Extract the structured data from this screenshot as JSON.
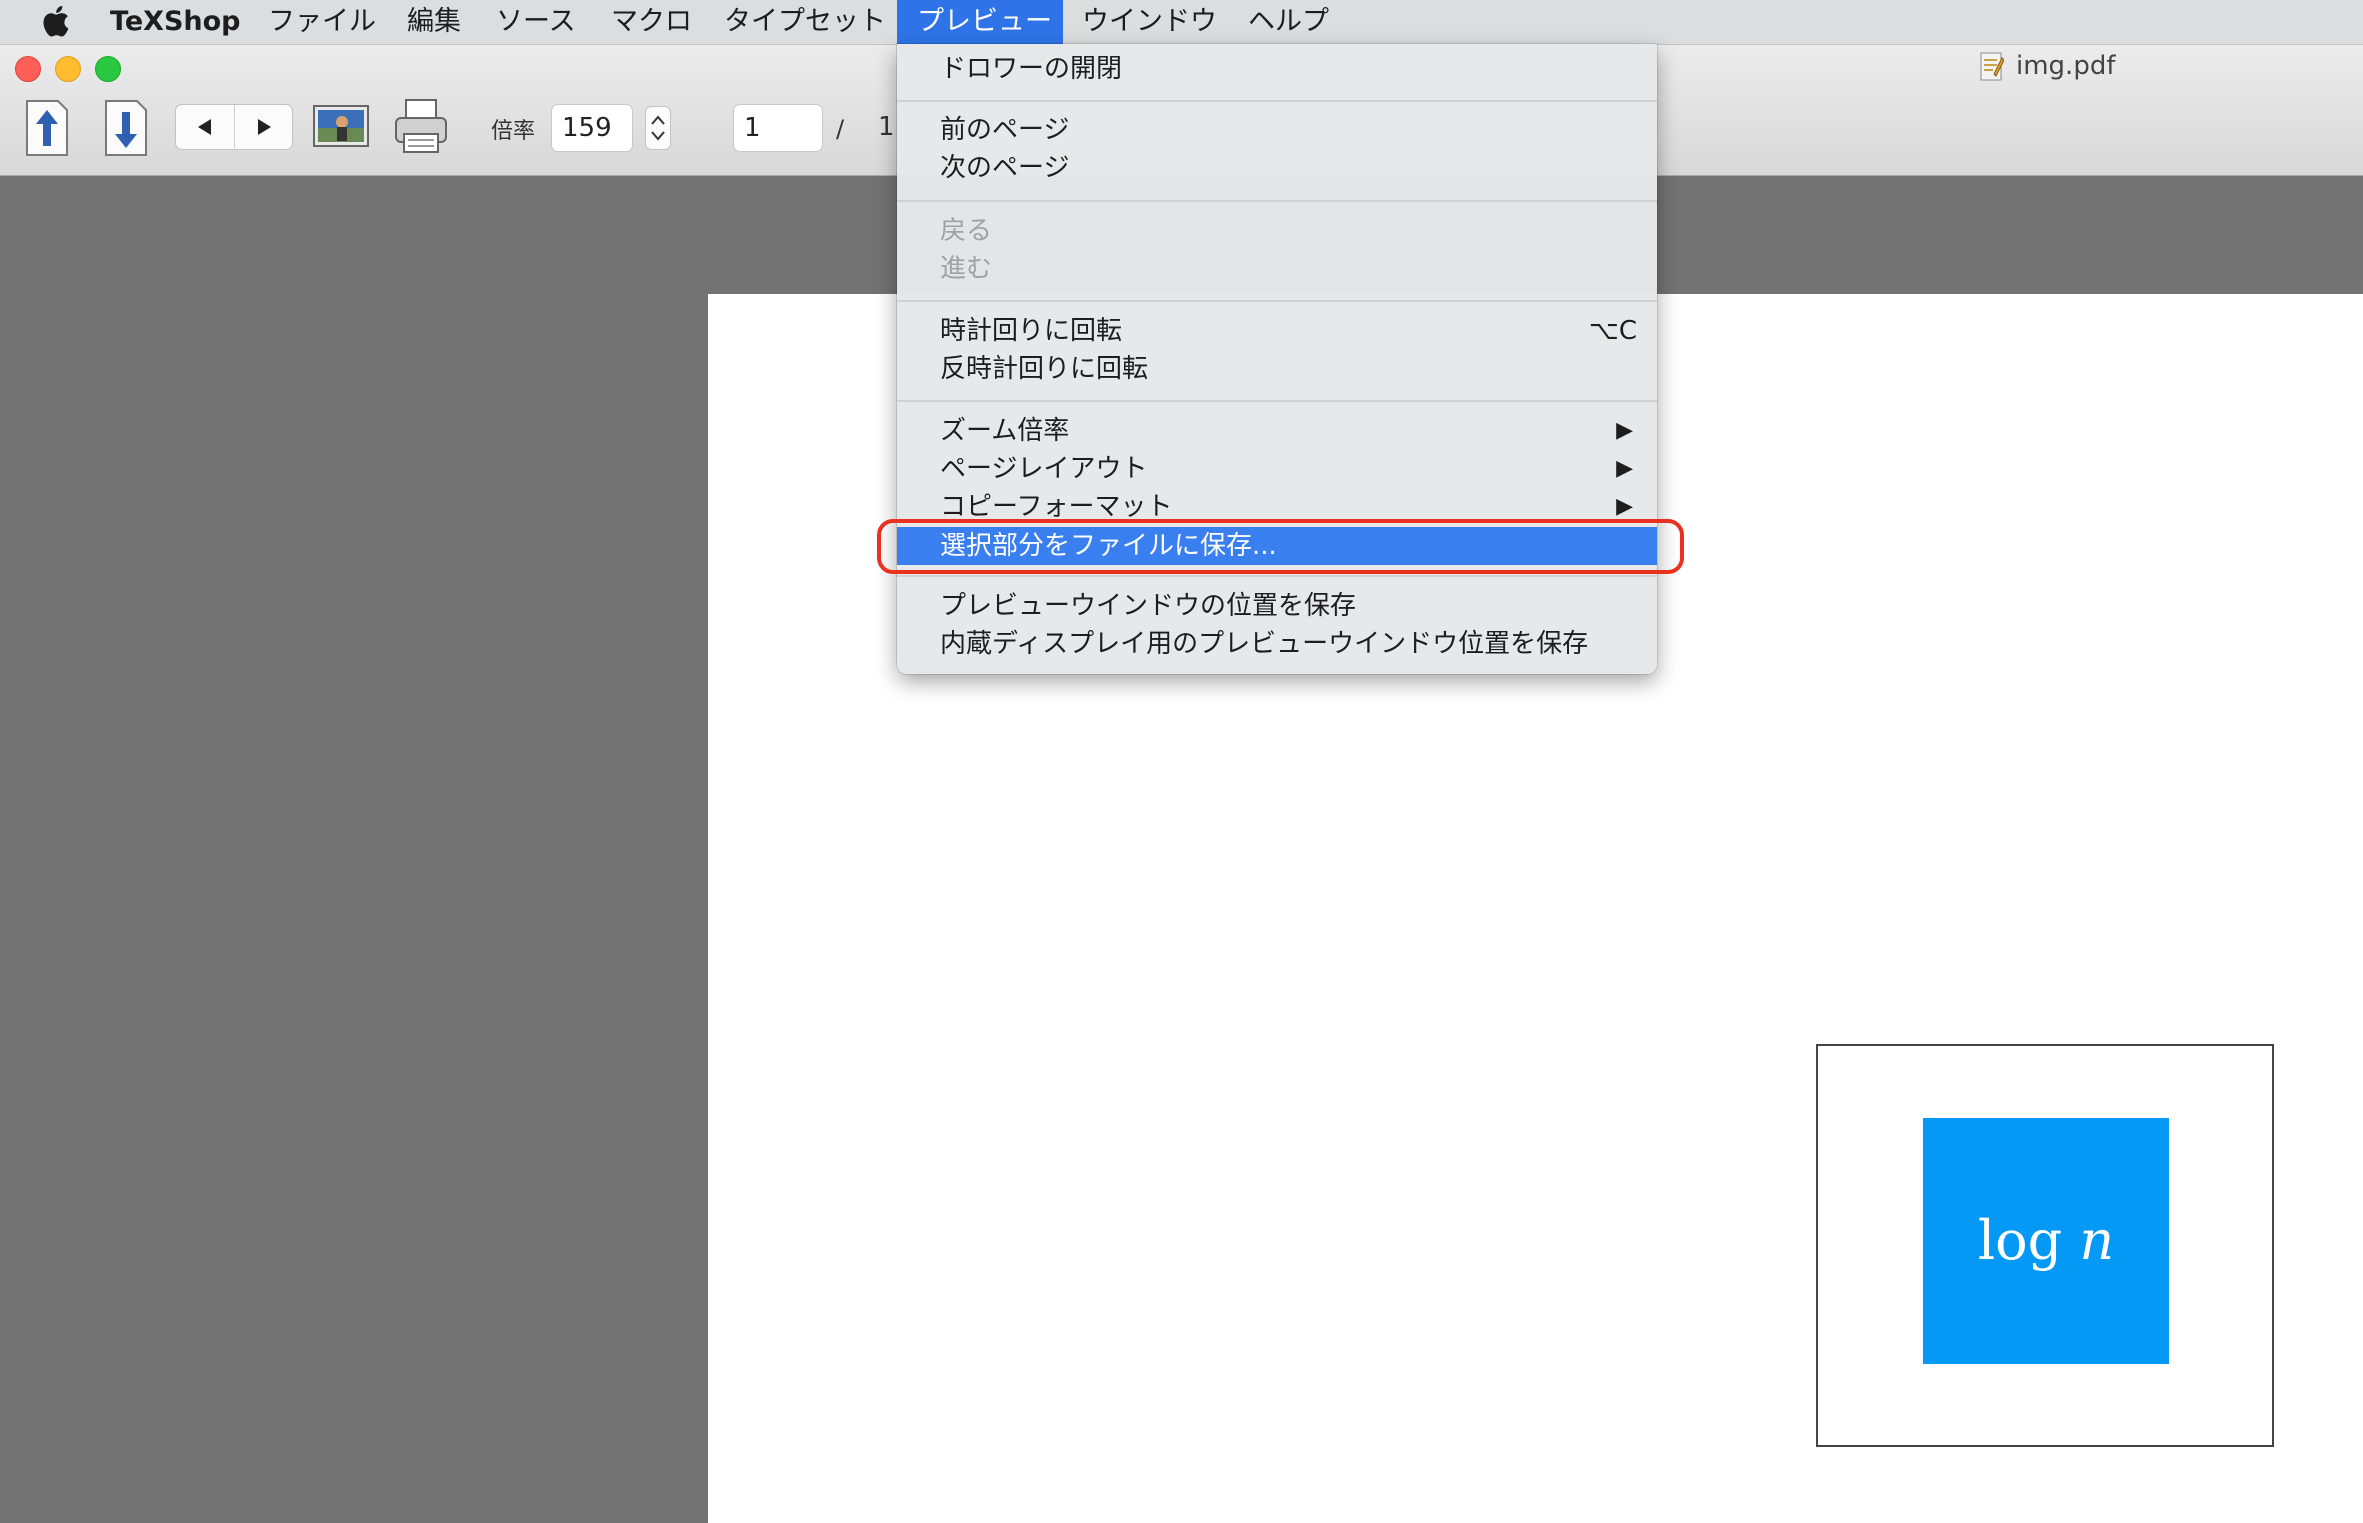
{
  "menubar": {
    "app_name": "TeXShop",
    "items": [
      "ファイル",
      "編集",
      "ソース",
      "マクロ",
      "タイプセット",
      "プレビュー",
      "ウインドウ",
      "ヘルプ"
    ]
  },
  "window": {
    "title": "img.pdf"
  },
  "toolbar": {
    "zoom_label": "倍率",
    "zoom_value": "159",
    "page_value": "1",
    "page_separator": "/",
    "page_total": "1"
  },
  "preview_menu": {
    "drawer": "ドロワーの開閉",
    "prev_page": "前のページ",
    "next_page": "次のページ",
    "back": "戻る",
    "forward": "進む",
    "rotate_cw": "時計回りに回転",
    "rotate_cw_shortcut": "⌥C",
    "rotate_ccw": "反時計回りに回転",
    "zoom": "ズーム倍率",
    "page_layout": "ページレイアウト",
    "copy_format": "コピーフォーマット",
    "save_selection": "選択部分をファイルに保存...",
    "save_window_pos": "プレビューウインドウの位置を保存",
    "save_builtin_pos": "内蔵ディスプレイ用のプレビューウインドウ位置を保存"
  },
  "document": {
    "formula_text": "log",
    "formula_var": "n"
  },
  "colors": {
    "menu_highlight": "#3a7ff0",
    "active_menu": "#2e74e8",
    "callout_border": "#e8321f",
    "formula_box": "#0399f5"
  }
}
